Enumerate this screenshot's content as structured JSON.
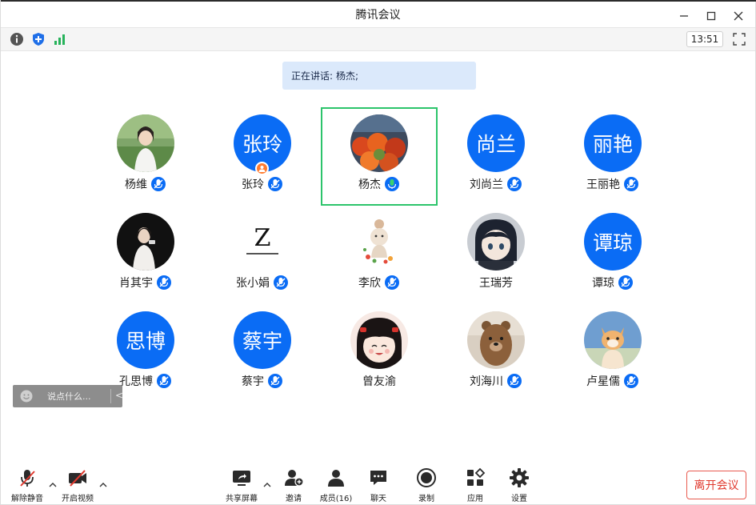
{
  "window": {
    "title": "腾讯会议",
    "controls": [
      "minimize",
      "maximize",
      "close"
    ]
  },
  "toolbar": {
    "icons": [
      "info-icon",
      "shield-icon",
      "signal-icon"
    ],
    "clock": "13:51",
    "fullscreen_icon": "fullscreen-icon"
  },
  "speaking": {
    "label": "正在讲话:",
    "speaker": "杨杰;"
  },
  "participants": [
    {
      "name": "杨维",
      "avatar": "photo",
      "mic": "muted"
    },
    {
      "name": "张玲",
      "avatar": "张玲",
      "mic": "muted",
      "host": true
    },
    {
      "name": "杨杰",
      "avatar": "photo",
      "mic": "active",
      "active": true
    },
    {
      "name": "刘尚兰",
      "avatar": "尚兰",
      "mic": "muted"
    },
    {
      "name": "王丽艳",
      "avatar": "丽艳",
      "mic": "muted"
    },
    {
      "name": "肖其宇",
      "avatar": "photo",
      "mic": "muted"
    },
    {
      "name": "张小娟",
      "avatar": "photo",
      "mic": "muted"
    },
    {
      "name": "李欣",
      "avatar": "photo",
      "mic": "muted"
    },
    {
      "name": "王瑞芳",
      "avatar": "photo",
      "mic": "none"
    },
    {
      "name": "谭琼",
      "avatar": "谭琼",
      "mic": "muted"
    },
    {
      "name": "孔思博",
      "avatar": "思博",
      "mic": "muted"
    },
    {
      "name": "蔡宇",
      "avatar": "蔡宇",
      "mic": "muted"
    },
    {
      "name": "曾友渝",
      "avatar": "photo",
      "mic": "none"
    },
    {
      "name": "刘海川",
      "avatar": "photo",
      "mic": "muted"
    },
    {
      "name": "卢星儒",
      "avatar": "photo",
      "mic": "muted"
    }
  ],
  "avatar_texts": {
    "zhangling": "张玲",
    "shanglan": "尚兰",
    "liyan": "丽艳",
    "tanqiong": "谭琼",
    "sibo": "思博",
    "caiyu": "蔡宇",
    "zzz_logo": "Z"
  },
  "chat": {
    "placeholder": "说点什么..."
  },
  "bottom_bar": {
    "unmute": "解除静音",
    "start_video": "开启视频",
    "share_screen": "共享屏幕",
    "invite": "邀请",
    "members": "成员(16)",
    "chat": "聊天",
    "record": "录制",
    "apps": "应用",
    "settings": "设置",
    "leave": "离开会议"
  },
  "colors": {
    "accent_blue": "#0a6cf5",
    "active_green": "#2cc46b",
    "leave_red": "#e0392e",
    "speaking_bg": "#dbe9fb",
    "host_orange": "#ff7a2e"
  }
}
